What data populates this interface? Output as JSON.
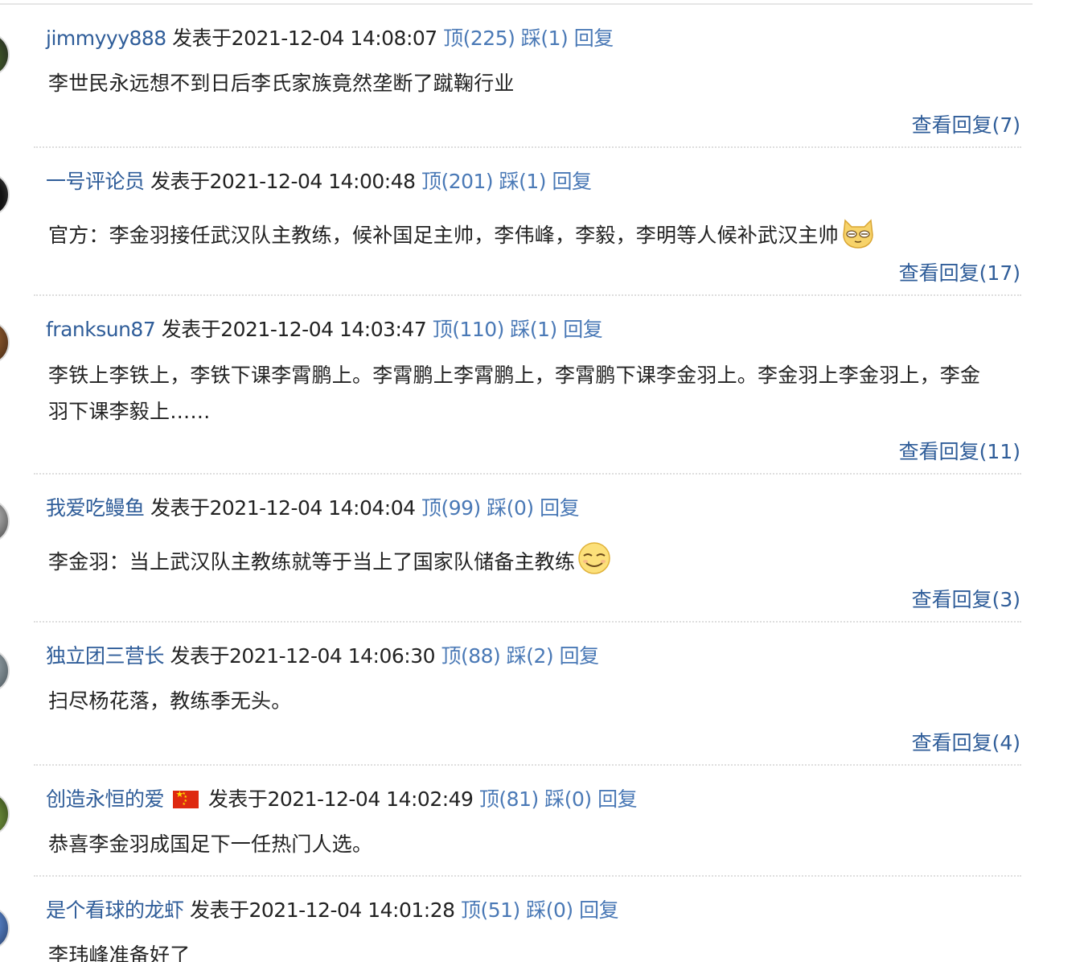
{
  "labels": {
    "posted_at": "发表于",
    "reply": "回复"
  },
  "comments": [
    {
      "user": "jimmyyy888",
      "time": "2021-12-04 14:08:07",
      "up": "顶(225)",
      "down": "踩(1)",
      "text": "李世民永远想不到日后李氏家族竟然垄断了蹴鞠行业",
      "view_replies": "查看回复(7)"
    },
    {
      "user": "一号评论员",
      "time": "2021-12-04 14:00:48",
      "up": "顶(201)",
      "down": "踩(1)",
      "text": "官方：李金羽接任武汉队主教练，候补国足主帅，李伟峰，李毅，李明等人候补武汉主帅",
      "emoji": "cat-emoji",
      "view_replies": "查看回复(17)"
    },
    {
      "user": "franksun87",
      "time": "2021-12-04 14:03:47",
      "up": "顶(110)",
      "down": "踩(1)",
      "text": "李铁上李铁上，李铁下课李霄鹏上。李霄鹏上李霄鹏上，李霄鹏下课李金羽上。李金羽上李金羽上，李金羽下课李毅上……",
      "view_replies": "查看回复(11)"
    },
    {
      "user": "我爱吃鳗鱼",
      "time": "2021-12-04 14:04:04",
      "up": "顶(99)",
      "down": "踩(0)",
      "text": "李金羽：当上武汉队主教练就等于当上了国家队储备主教练",
      "emoji": "smirk-emoji",
      "view_replies": "查看回复(3)"
    },
    {
      "user": "独立团三营长",
      "time": "2021-12-04 14:06:30",
      "up": "顶(88)",
      "down": "踩(2)",
      "text": "扫尽杨花落，教练季无头。",
      "view_replies": "查看回复(4)"
    },
    {
      "user": "创造永恒的爱",
      "flag": "china-flag-icon",
      "time": "2021-12-04 14:02:49",
      "up": "顶(81)",
      "down": "踩(0)",
      "text": "恭喜李金羽成国足下一任热门人选。"
    },
    {
      "user": "是个看球的龙虾",
      "time": "2021-12-04 14:01:28",
      "up": "顶(51)",
      "down": "踩(0)",
      "text": "李玮峰准备好了"
    }
  ]
}
